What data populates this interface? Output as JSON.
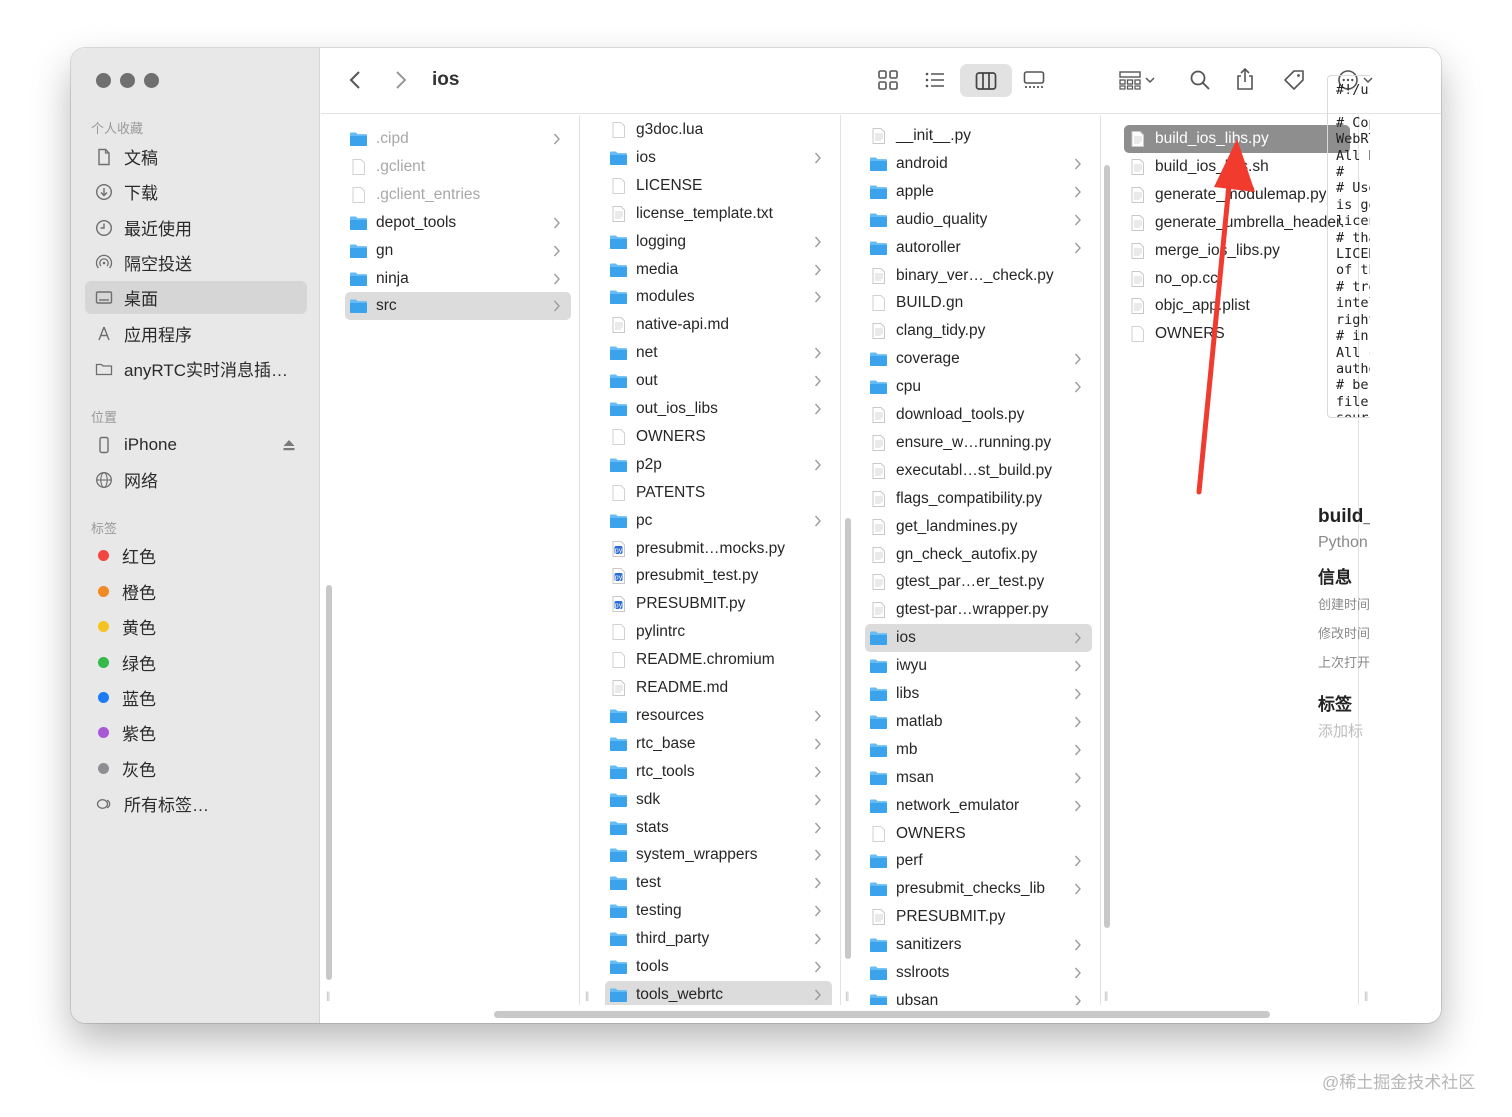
{
  "window": {
    "title": "ios"
  },
  "sidebar": {
    "favorites_header": "个人收藏",
    "favorites": [
      {
        "label": "文稿",
        "icon": "document-icon"
      },
      {
        "label": "下载",
        "icon": "download-icon"
      },
      {
        "label": "最近使用",
        "icon": "clock-icon"
      },
      {
        "label": "隔空投送",
        "icon": "airdrop-icon"
      },
      {
        "label": "桌面",
        "icon": "desktop-icon",
        "selected": true
      },
      {
        "label": "应用程序",
        "icon": "applications-icon"
      },
      {
        "label": "anyRTC实时消息插…",
        "icon": "folder-icon"
      }
    ],
    "locations_header": "位置",
    "locations": [
      {
        "label": "iPhone",
        "icon": "iphone-icon"
      },
      {
        "label": "网络",
        "icon": "network-icon"
      }
    ],
    "tags_header": "标签",
    "tags": [
      {
        "label": "红色",
        "color": "#f2473e"
      },
      {
        "label": "橙色",
        "color": "#f08a24"
      },
      {
        "label": "黄色",
        "color": "#f5c320"
      },
      {
        "label": "绿色",
        "color": "#35b94a"
      },
      {
        "label": "蓝色",
        "color": "#1e7af5"
      },
      {
        "label": "紫色",
        "color": "#a958d6"
      },
      {
        "label": "灰色",
        "color": "#8e8e93"
      }
    ],
    "all_tags": "所有标签…"
  },
  "columns": [
    [
      {
        "name": ".cipd",
        "type": "folder",
        "dim": true
      },
      {
        "name": ".gclient",
        "type": "file",
        "dim": true
      },
      {
        "name": ".gclient_entries",
        "type": "file",
        "dim": true
      },
      {
        "name": "depot_tools",
        "type": "folder"
      },
      {
        "name": "gn",
        "type": "folder"
      },
      {
        "name": "ninja",
        "type": "folder"
      },
      {
        "name": "src",
        "type": "folder",
        "selected": true
      }
    ],
    [
      {
        "name": "g3doc.lua",
        "type": "file"
      },
      {
        "name": "ios",
        "type": "folder"
      },
      {
        "name": "LICENSE",
        "type": "file"
      },
      {
        "name": "license_template.txt",
        "type": "text"
      },
      {
        "name": "logging",
        "type": "folder"
      },
      {
        "name": "media",
        "type": "folder"
      },
      {
        "name": "modules",
        "type": "folder"
      },
      {
        "name": "native-api.md",
        "type": "text"
      },
      {
        "name": "net",
        "type": "folder"
      },
      {
        "name": "out",
        "type": "folder"
      },
      {
        "name": "out_ios_libs",
        "type": "folder"
      },
      {
        "name": "OWNERS",
        "type": "file"
      },
      {
        "name": "p2p",
        "type": "folder"
      },
      {
        "name": "PATENTS",
        "type": "file"
      },
      {
        "name": "pc",
        "type": "folder"
      },
      {
        "name": "presubmit…mocks.py",
        "type": "python"
      },
      {
        "name": "presubmit_test.py",
        "type": "python"
      },
      {
        "name": "PRESUBMIT.py",
        "type": "python"
      },
      {
        "name": "pylintrc",
        "type": "file"
      },
      {
        "name": "README.chromium",
        "type": "file"
      },
      {
        "name": "README.md",
        "type": "text"
      },
      {
        "name": "resources",
        "type": "folder"
      },
      {
        "name": "rtc_base",
        "type": "folder"
      },
      {
        "name": "rtc_tools",
        "type": "folder"
      },
      {
        "name": "sdk",
        "type": "folder"
      },
      {
        "name": "stats",
        "type": "folder"
      },
      {
        "name": "system_wrappers",
        "type": "folder"
      },
      {
        "name": "test",
        "type": "folder"
      },
      {
        "name": "testing",
        "type": "folder"
      },
      {
        "name": "third_party",
        "type": "folder"
      },
      {
        "name": "tools",
        "type": "folder"
      },
      {
        "name": "tools_webrtc",
        "type": "folder",
        "selected": true
      }
    ],
    [
      {
        "name": "__init__.py",
        "type": "text"
      },
      {
        "name": "android",
        "type": "folder"
      },
      {
        "name": "apple",
        "type": "folder"
      },
      {
        "name": "audio_quality",
        "type": "folder"
      },
      {
        "name": "autoroller",
        "type": "folder"
      },
      {
        "name": "binary_ver…_check.py",
        "type": "text"
      },
      {
        "name": "BUILD.gn",
        "type": "file"
      },
      {
        "name": "clang_tidy.py",
        "type": "text"
      },
      {
        "name": "coverage",
        "type": "folder"
      },
      {
        "name": "cpu",
        "type": "folder"
      },
      {
        "name": "download_tools.py",
        "type": "text"
      },
      {
        "name": "ensure_w…running.py",
        "type": "text"
      },
      {
        "name": "executabl…st_build.py",
        "type": "text"
      },
      {
        "name": "flags_compatibility.py",
        "type": "text"
      },
      {
        "name": "get_landmines.py",
        "type": "text"
      },
      {
        "name": "gn_check_autofix.py",
        "type": "text"
      },
      {
        "name": "gtest_par…er_test.py",
        "type": "text"
      },
      {
        "name": "gtest-par…wrapper.py",
        "type": "text"
      },
      {
        "name": "ios",
        "type": "folder",
        "selected": true
      },
      {
        "name": "iwyu",
        "type": "folder"
      },
      {
        "name": "libs",
        "type": "folder"
      },
      {
        "name": "matlab",
        "type": "folder"
      },
      {
        "name": "mb",
        "type": "folder"
      },
      {
        "name": "msan",
        "type": "folder"
      },
      {
        "name": "network_emulator",
        "type": "folder"
      },
      {
        "name": "OWNERS",
        "type": "file"
      },
      {
        "name": "perf",
        "type": "folder"
      },
      {
        "name": "presubmit_checks_lib",
        "type": "folder"
      },
      {
        "name": "PRESUBMIT.py",
        "type": "text"
      },
      {
        "name": "sanitizers",
        "type": "folder"
      },
      {
        "name": "sslroots",
        "type": "folder"
      },
      {
        "name": "ubsan",
        "type": "folder"
      }
    ],
    [
      {
        "name": "build_ios_libs.py",
        "type": "text",
        "active": true
      },
      {
        "name": "build_ios_libs.sh",
        "type": "text"
      },
      {
        "name": "generate_modulemap.py",
        "type": "text"
      },
      {
        "name": "generate_umbrella_header.py",
        "type": "text"
      },
      {
        "name": "merge_ios_libs.py",
        "type": "text"
      },
      {
        "name": "no_op.cc",
        "type": "text"
      },
      {
        "name": "objc_app.plist",
        "type": "text"
      },
      {
        "name": "OWNERS",
        "type": "file"
      }
    ]
  ],
  "col4_display": [
    "build_ios_libs.py",
    "build_ios",
    "ps.sh",
    "generate",
    ".ulemap.py",
    "generate",
    "..header.py",
    "merge_i",
    "_libs.py",
    "no_op.c",
    "objc_ap",
    ".plist",
    "OWNER",
    "S"
  ],
  "preview": {
    "code_lines": [
      "#!/us",
      "",
      "# Cop",
      "WebRT",
      "All R",
      "#",
      "# Use",
      "is go",
      "licen",
      "# tha",
      "LICEN",
      "of th",
      "# tre",
      "intel",
      "right",
      "# in",
      "All c",
      "autho",
      "# be",
      "file",
      "sourc"
    ],
    "filename": "build_",
    "kind": "Python",
    "info_label": "信息",
    "created": "创建时间",
    "modified": "修改时间",
    "last_opened": "上次打开",
    "tags_label": "标签",
    "add_tags": "添加标"
  },
  "watermark": "@稀土掘金技术社区",
  "colors": {
    "folder": "#3aa3ec",
    "folder_light": "#66bdf5",
    "arrow": "#f23b2f"
  }
}
